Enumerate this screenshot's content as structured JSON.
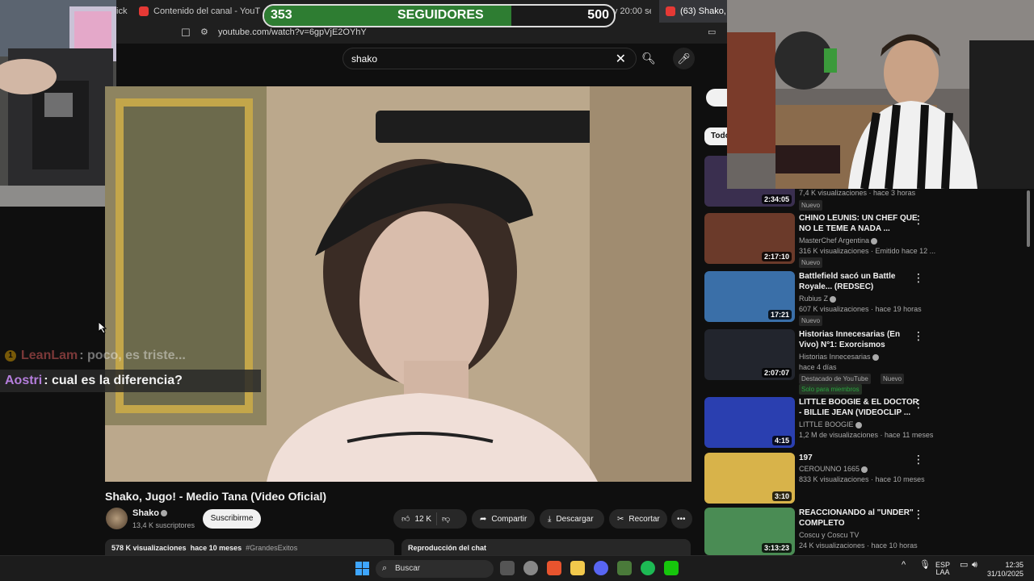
{
  "browser": {
    "tabs": [
      {
        "label": "ick",
        "color": "#888888"
      },
      {
        "label": "Contenido del canal - YouTube Studi",
        "color": "#e53935"
      },
      {
        "label": "Coscu en X: \"Hoy 20:00 se pica https:",
        "color": "#000000"
      },
      {
        "label": "(63) Shako, Jugo",
        "color": "#e53935"
      }
    ],
    "url": "youtube.com/watch?v=6gpVjE2OYhY"
  },
  "followers": {
    "current": "353",
    "label": "SEGUIDORES",
    "goal": "500",
    "progress": 0.706
  },
  "search": {
    "query": "shako"
  },
  "video": {
    "title": "Shako, Jugo! - Medio Tana (Video Oficial)",
    "channel": "Shako",
    "subscribers": "13,4 K suscriptores",
    "subscribe_label": "Suscribirme",
    "likes": "12 K",
    "share_label": "Compartir",
    "download_label": "Descargar",
    "clip_label": "Recortar",
    "views": "578 K visualizaciones",
    "age": "hace 10 meses",
    "hashtag": "#GrandesExitos",
    "chat_replay": "Reproducción del chat"
  },
  "chat": [
    {
      "user": "LeanLam",
      "text": ": poco, es triste...",
      "faded": true
    },
    {
      "user": "Aostri",
      "text": ": cual es la diferencia?",
      "faded": false
    }
  ],
  "sidebar": {
    "chip_all": "Todo",
    "recs": [
      {
        "title": "",
        "channel": "",
        "meta": "7,4 K visualizaciones · hace 3 horas",
        "badge": "Nuevo",
        "duration": "2:34:05",
        "color": "#3a2f4f"
      },
      {
        "title": "CHINO LEUNIS: UN CHEF QUE NO LE TEME A NADA ...",
        "channel": "MasterChef Argentina",
        "meta": "316 K visualizaciones · Emitido hace 12 ...",
        "badge": "Nuevo",
        "duration": "2:17:10",
        "color": "#6b3a2a"
      },
      {
        "title": "Battlefield sacó un Battle Royale... (REDSEC)",
        "channel": "Rubius Z",
        "meta": "607 K visualizaciones · hace 19 horas",
        "badge": "Nuevo",
        "duration": "17:21",
        "color": "#3a6fa8"
      },
      {
        "title": "Historias Innecesarias (En Vivo) N°1: Exorcismos",
        "channel": "Historias Innecesarias",
        "meta": "hace 4 días",
        "badge": "Destacado de YouTube",
        "badge2": "Nuevo",
        "members": "Solo para miembros",
        "duration": "2:07:07",
        "color": "#22252d"
      },
      {
        "title": "LITTLE BOOGIE & EL DOCTOR - BILLIE JEAN (VIDEOCLIP ...",
        "channel": "LITTLE BOOGIE",
        "meta": "1,2 M de visualizaciones · hace 11 meses",
        "duration": "4:15",
        "color": "#2a3fb0"
      },
      {
        "title": "197",
        "channel": "CEROUNNO 1665",
        "meta": "833 K visualizaciones · hace 10 meses",
        "duration": "3:10",
        "color": "#d8b34a"
      },
      {
        "title": "REACCIONANDO al \"UNDER\" COMPLETO",
        "channel": "Coscu y Coscu TV",
        "meta": "24 K visualizaciones · hace 10 horas",
        "duration": "3:13:23",
        "color": "#4a8c54"
      }
    ]
  },
  "taskbar": {
    "search_label": "Buscar",
    "lang_top": "ESP",
    "lang_bottom": "LAA",
    "time": "12:35",
    "date": "31/10/2025"
  }
}
